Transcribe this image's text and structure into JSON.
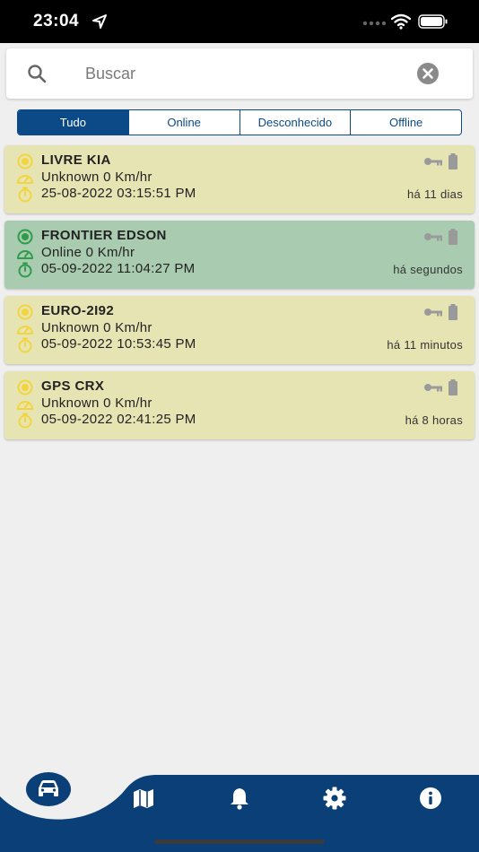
{
  "status_bar": {
    "time": "23:04"
  },
  "search": {
    "placeholder": "Buscar",
    "value": ""
  },
  "tabs": [
    {
      "label": "Tudo",
      "active": true
    },
    {
      "label": "Online",
      "active": false
    },
    {
      "label": "Desconhecido",
      "active": false
    },
    {
      "label": "Offline",
      "active": false
    }
  ],
  "devices": [
    {
      "name": "LIVRE KIA",
      "status": "Unknown 0 Km/hr",
      "timestamp": "25-08-2022 03:15:51 PM",
      "ago": "há 11 dias",
      "state": "unknown"
    },
    {
      "name": "FRONTIER EDSON",
      "status": "Online 0 Km/hr",
      "timestamp": "05-09-2022 11:04:27 PM",
      "ago": "há segundos",
      "state": "online"
    },
    {
      "name": "EURO-2I92",
      "status": "Unknown 0 Km/hr",
      "timestamp": "05-09-2022 10:53:45 PM",
      "ago": "há 11 minutos",
      "state": "unknown"
    },
    {
      "name": "GPS CRX",
      "status": "Unknown 0 Km/hr",
      "timestamp": "05-09-2022 02:41:25 PM",
      "ago": "há 8 horas",
      "state": "unknown"
    }
  ],
  "nav": {
    "items": [
      "car-icon",
      "map-icon",
      "bell-icon",
      "gear-icon",
      "info-icon"
    ],
    "active": "car-icon"
  },
  "colors": {
    "primary": "#0b4a86",
    "unknown": "#e7e4b4",
    "online": "#a9cbb0",
    "unknown_icon": "#f2d53c",
    "online_icon": "#2e9c4a"
  }
}
